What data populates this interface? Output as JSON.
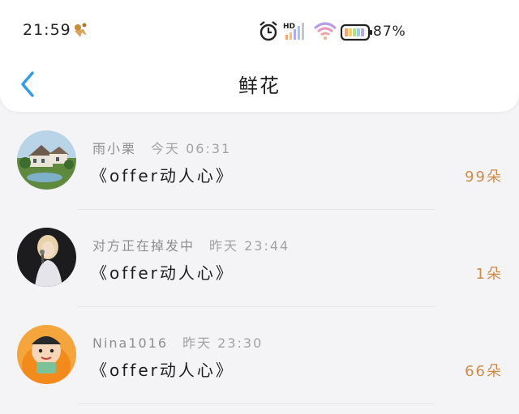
{
  "status_bar": {
    "time": "21:59",
    "network_label": "HD",
    "battery_percent": "87%",
    "battery_level": 0.87
  },
  "header": {
    "title": "鲜花",
    "back_icon": "chevron-left-icon"
  },
  "colors": {
    "accent_blue": "#2f9be8",
    "count_orange": "#d08a47"
  },
  "items": [
    {
      "name": "雨小栗",
      "time": "今天 06:31",
      "gift": "《offer动人心》",
      "count": "99朵"
    },
    {
      "name": "对方正在掉发中",
      "time": "昨天 23:44",
      "gift": "《offer动人心》",
      "count": "1朵"
    },
    {
      "name": "Nina1016",
      "time": "昨天 23:30",
      "gift": "《offer动人心》",
      "count": "66朵"
    }
  ]
}
